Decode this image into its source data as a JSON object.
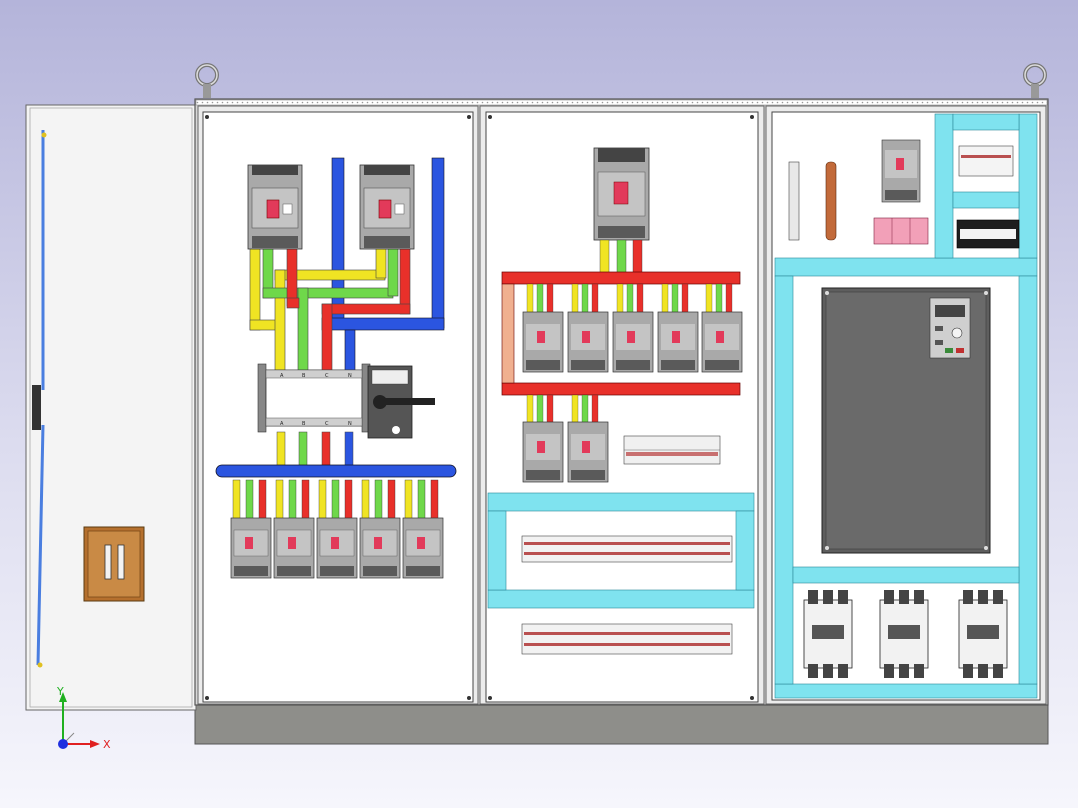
{
  "axes": {
    "x_label": "X",
    "y_label": "Y"
  },
  "switch_labels": [
    "A",
    "B",
    "C",
    "N"
  ],
  "colors": {
    "background_top": "#b6b6dc",
    "background_bottom": "#f4f4fb",
    "panel": "#ffffff",
    "frame": "#d9d9d9",
    "cyan_rail": "#7fe3ef",
    "busbar_red": "#e8302a",
    "busbar_blue": "#2b55e0",
    "busbar_yellow": "#f0e423",
    "busbar_green": "#6fd84a",
    "breaker_body": "#a9a9a9",
    "breaker_handle": "#e23a5a",
    "plinth": "#8c8c88",
    "door_handle": "#b0682a",
    "axis_x": "#e02020",
    "axis_y": "#20b020",
    "axis_z": "#2030e0"
  },
  "icons": {
    "lifting_eye": "lifting-eye-icon",
    "axis_triad": "axis-triad-icon",
    "rotary_switch": "rotary-switch-icon",
    "keypad": "vfd-keypad-icon"
  }
}
